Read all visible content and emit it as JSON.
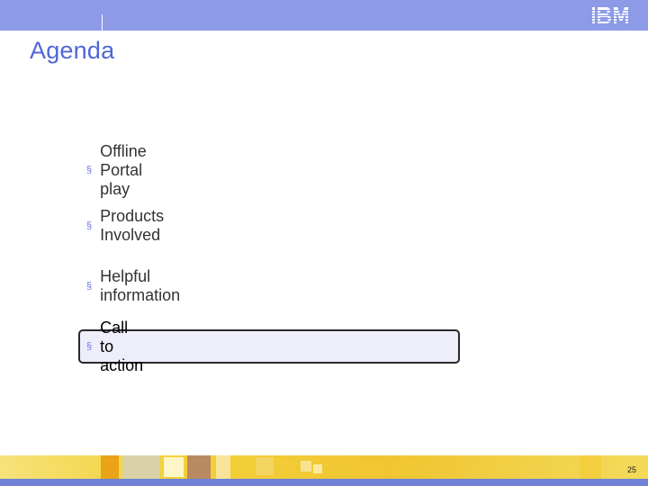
{
  "header": {
    "logo_text": "IBM",
    "title": "Agenda"
  },
  "agenda": {
    "items": [
      {
        "label": "Offline Portal play"
      },
      {
        "label": "Products Involved"
      },
      {
        "label": "Helpful information"
      },
      {
        "label": "Call to action",
        "highlighted": true
      }
    ],
    "marker": "§"
  },
  "footer": {
    "page_number": "25"
  },
  "colors": {
    "header_bar": "#8c9ae8",
    "title": "#5166d6",
    "highlight_bg": "#eeeefb",
    "footer_band": "#f0c531",
    "footer_stripe": "#6f82d4"
  }
}
